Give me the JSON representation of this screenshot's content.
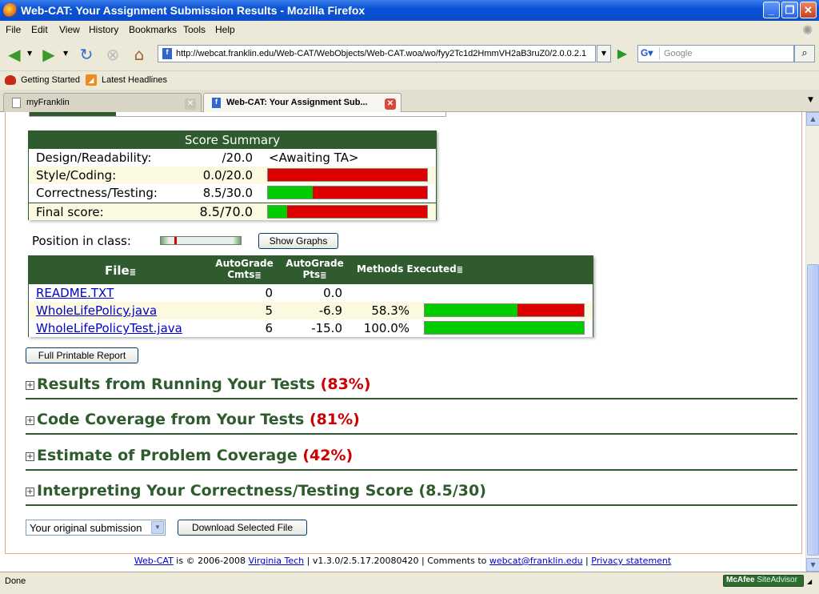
{
  "window": {
    "title": "Web-CAT: Your Assignment Submission Results - Mozilla Firefox"
  },
  "menu": [
    "File",
    "Edit",
    "View",
    "History",
    "Bookmarks",
    "Tools",
    "Help"
  ],
  "nav": {
    "url": "http://webcat.franklin.edu/Web-CAT/WebObjects/Web-CAT.woa/wo/fyy2Tc1d2HmmVH2aB3ruZ0/2.0.0.2.1",
    "search_placeholder": "Google"
  },
  "bookmarks": [
    "Getting Started",
    "Latest Headlines"
  ],
  "tabs": [
    {
      "label": "myFranklin"
    },
    {
      "label": "Web-CAT: Your Assignment Sub..."
    }
  ],
  "score_summary": {
    "title": "Score Summary",
    "rows": [
      {
        "label": "Design/Readability:",
        "score": "/20.0",
        "note": "<Awaiting TA>"
      },
      {
        "label": "Style/Coding:",
        "score": "0.0/20.0",
        "fraction": 0.0
      },
      {
        "label": "Correctness/Testing:",
        "score": "8.5/30.0",
        "fraction": 0.283
      },
      {
        "label": "Final score:",
        "score": "8.5/70.0",
        "fraction": 0.121
      }
    ]
  },
  "position": {
    "label": "Position in class:",
    "fraction": 0.17,
    "button": "Show Graphs"
  },
  "files_table": {
    "headers": {
      "file": "File",
      "cmts_1": "AutoGrade",
      "cmts_2": "Cmts",
      "pts_1": "AutoGrade",
      "pts_2": "Pts",
      "methods": "Methods Executed"
    },
    "rows": [
      {
        "file": "README.TXT",
        "cmts": "0",
        "pts": "0.0",
        "methods": "",
        "fraction": null
      },
      {
        "file": "WholeLifePolicy.java",
        "cmts": "5",
        "pts": "-6.9",
        "methods": "58.3%",
        "fraction": 0.583
      },
      {
        "file": "WholeLifePolicyTest.java",
        "cmts": "6",
        "pts": "-15.0",
        "methods": "100.0%",
        "fraction": 1.0
      }
    ]
  },
  "report_button": "Full Printable Report",
  "sections": [
    {
      "title": "Results from Running Your Tests",
      "pct": "(83%)"
    },
    {
      "title": "Code Coverage from Your Tests",
      "pct": "(81%)"
    },
    {
      "title": "Estimate of Problem Coverage",
      "pct": "(42%)"
    },
    {
      "title": "Interpreting Your Correctness/Testing Score (8.5/30)",
      "pct": ""
    }
  ],
  "download": {
    "select_value": "Your original submission",
    "button": "Download Selected File"
  },
  "footer": {
    "webcat": "Web-CAT",
    "is": " is © 2006-2008 ",
    "vt": "Virginia Tech",
    "version": " | v1.3.0/2.5.17.20080420 | Comments to ",
    "email": "webcat@franklin.edu",
    "sep": " | ",
    "privacy": "Privacy statement"
  },
  "status": {
    "text": "Done",
    "mcafee_1": "McAfee",
    "mcafee_2": "SiteAdvisor"
  },
  "colors": {
    "header_green": "#2f5b2e",
    "bar_green": "#00cc00",
    "bar_red": "#dd0000",
    "pct_red": "#cc0000"
  }
}
